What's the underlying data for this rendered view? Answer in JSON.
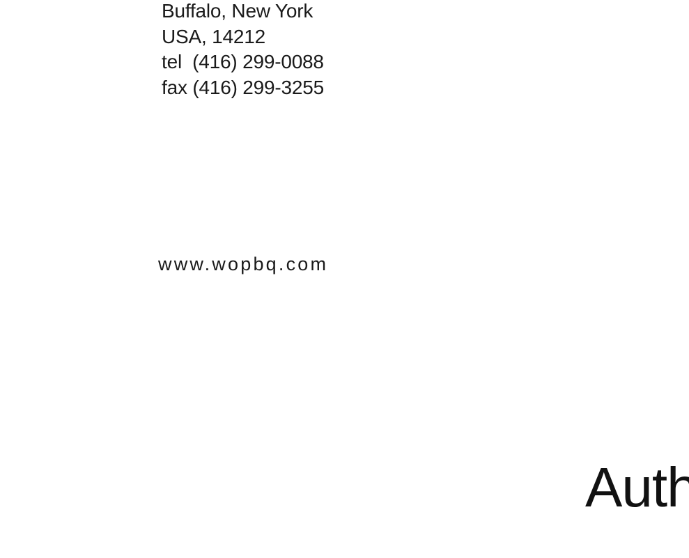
{
  "contact": {
    "lines": [
      "Buffalo, New York",
      "USA, 14212",
      "tel  (416) 299-0088",
      "fax (416) 299-3255"
    ],
    "website": "www.wopbq.com"
  },
  "heading_fragment": "Auth"
}
